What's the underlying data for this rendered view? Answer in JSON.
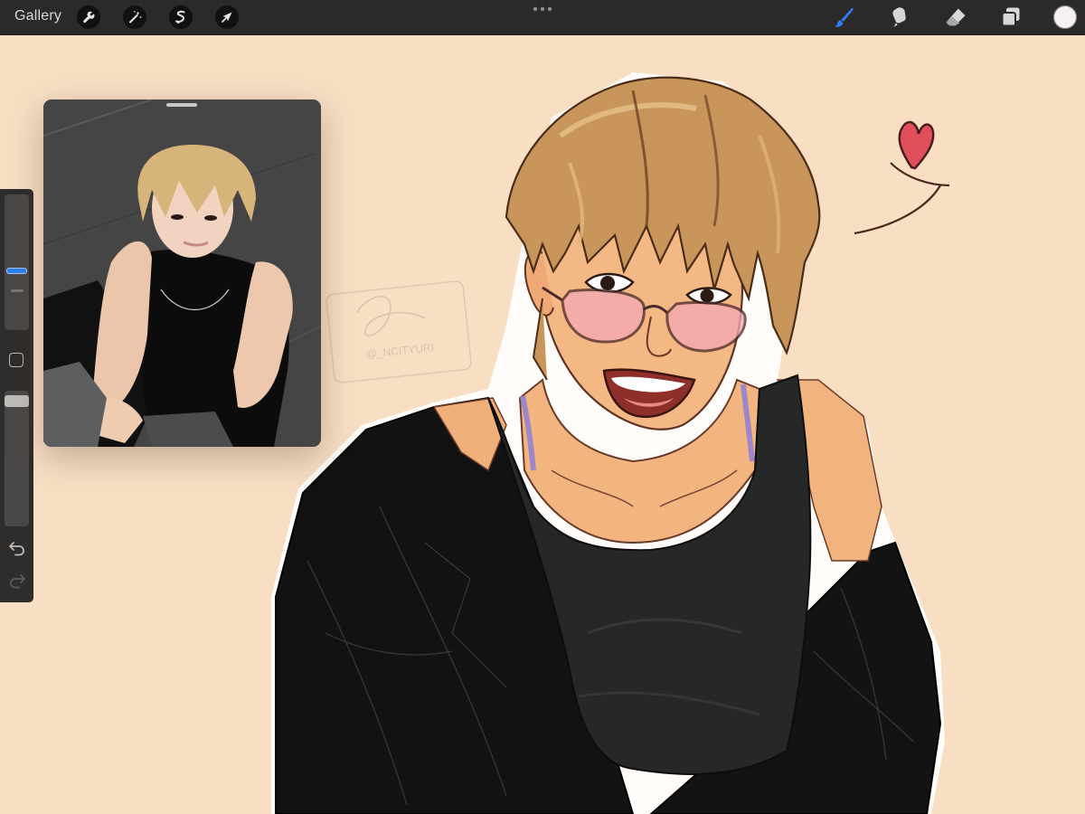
{
  "app": {
    "name": "Procreate"
  },
  "topbar": {
    "gallery_label": "Gallery",
    "left_tools": [
      {
        "icon": "wrench-icon",
        "tooltip": "Actions"
      },
      {
        "icon": "magic-wand-icon",
        "tooltip": "Adjustments"
      },
      {
        "icon": "selection-icon",
        "tooltip": "Selection"
      },
      {
        "icon": "arrow-cursor-icon",
        "tooltip": "Transform"
      }
    ],
    "right_tools": [
      {
        "icon": "brush-icon",
        "active": true
      },
      {
        "icon": "smudge-icon",
        "active": false
      },
      {
        "icon": "eraser-icon",
        "active": false
      },
      {
        "icon": "layers-icon",
        "active": false
      }
    ],
    "current_color": "#f4f0f4",
    "active_tool_color": "#2f7ff0"
  },
  "sidebar": {
    "brush_size": 0.42,
    "brush_opacity": 0.96,
    "icons": [
      "modify-square-icon",
      "undo-icon",
      "redo-icon"
    ]
  },
  "reference": {
    "title": ""
  },
  "canvas": {
    "background": "#f8dfc4",
    "signature_text": "@_NCITYURI"
  }
}
